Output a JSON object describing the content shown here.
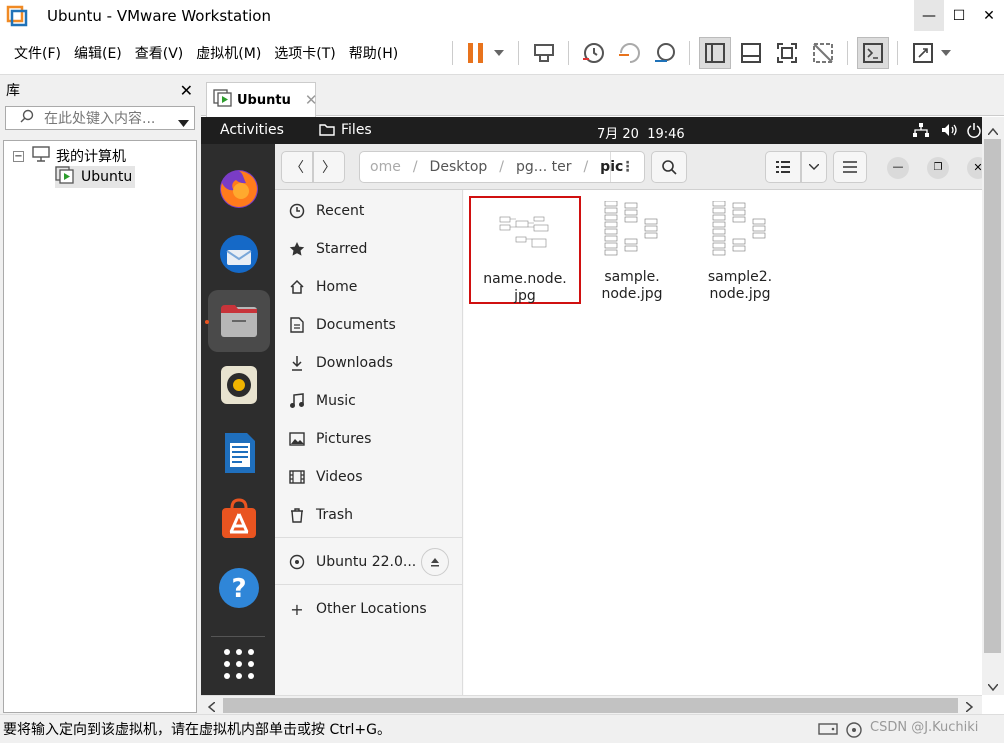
{
  "window": {
    "title": "Ubuntu - VMware Workstation"
  },
  "menu": [
    "文件(F)",
    "编辑(E)",
    "查看(V)",
    "虚拟机(M)",
    "选项卡(T)",
    "帮助(H)"
  ],
  "library": {
    "title": "库",
    "search_placeholder": "在此处键入内容...",
    "tree": {
      "root": "我的计算机",
      "child": "Ubuntu"
    }
  },
  "tab": {
    "label": "Ubuntu"
  },
  "guest": {
    "activities": "Activities",
    "app": "Files",
    "clock": "7月 20  19:46",
    "path": [
      "ome",
      "Desktop",
      "pg... ter",
      "pic"
    ],
    "sidebar": [
      {
        "label": "Recent",
        "icon": "clock-icon"
      },
      {
        "label": "Starred",
        "icon": "star-icon"
      },
      {
        "label": "Home",
        "icon": "home-icon"
      },
      {
        "label": "Documents",
        "icon": "document-icon"
      },
      {
        "label": "Downloads",
        "icon": "download-icon"
      },
      {
        "label": "Music",
        "icon": "music-icon"
      },
      {
        "label": "Pictures",
        "icon": "picture-icon"
      },
      {
        "label": "Videos",
        "icon": "video-icon"
      },
      {
        "label": "Trash",
        "icon": "trash-icon"
      }
    ],
    "device": "Ubuntu 22.0...",
    "other": "Other Locations",
    "files": [
      {
        "name": "name.node.\njpg",
        "line1": "name.node.",
        "line2": "jpg"
      },
      {
        "line1": "sample.",
        "line2": "node.jpg"
      },
      {
        "line1": "sample2.",
        "line2": "node.jpg"
      }
    ]
  },
  "status": {
    "message": "要将输入定向到该虚拟机，请在虚拟机内部单击或按 Ctrl+G。",
    "watermark": "CSDN @J.Kuchiki"
  },
  "colors": {
    "pause": "#e8731d",
    "highlight_border": "#d01010",
    "dock": "#2d2d2d",
    "topbar": "#1e1e1e"
  }
}
